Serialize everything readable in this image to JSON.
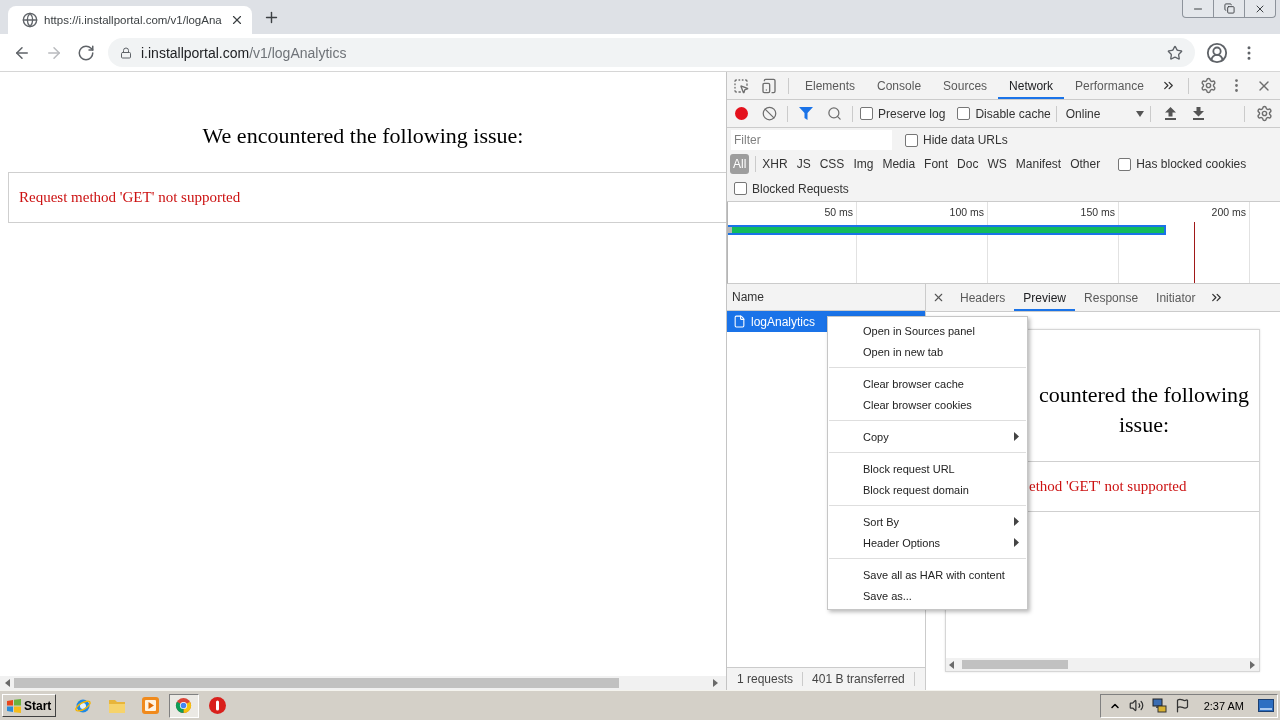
{
  "browser_tabs": [
    {
      "title": "https://i.installportal.com/v1/logAna",
      "selected": true
    }
  ],
  "address_bar": {
    "nav_buttons": [
      {
        "kind": "back",
        "disabled": false
      },
      {
        "kind": "forward",
        "disabled": true
      },
      {
        "kind": "reload",
        "disabled": false
      }
    ],
    "url_host": "i.installportal.com",
    "url_path": "/v1/logAnalytics"
  },
  "page": {
    "heading": "We encountered the following issue:",
    "error": "Request method 'GET' not supported"
  },
  "devtools": {
    "tabs": [
      {
        "label": "Elements",
        "selected": false
      },
      {
        "label": "Console",
        "selected": false
      },
      {
        "label": "Sources",
        "selected": false
      },
      {
        "label": "Network",
        "selected": true
      },
      {
        "label": "Performance",
        "selected": false
      }
    ],
    "toolbar": {
      "recording": true,
      "filter_active": true,
      "preserve_log": {
        "label": "Preserve log",
        "checked": false
      },
      "disable_cache": {
        "label": "Disable cache",
        "checked": false
      },
      "throttling": "Online"
    },
    "filter": {
      "placeholder": "Filter",
      "hide_data_urls": {
        "label": "Hide data URLs",
        "checked": false
      }
    },
    "type_filters": [
      {
        "label": "All",
        "selected": true
      },
      {
        "label": "XHR",
        "selected": false
      },
      {
        "label": "JS",
        "selected": false
      },
      {
        "label": "CSS",
        "selected": false
      },
      {
        "label": "Img",
        "selected": false
      },
      {
        "label": "Media",
        "selected": false
      },
      {
        "label": "Font",
        "selected": false
      },
      {
        "label": "Doc",
        "selected": false
      },
      {
        "label": "WS",
        "selected": false
      },
      {
        "label": "Manifest",
        "selected": false
      },
      {
        "label": "Other",
        "selected": false
      }
    ],
    "has_blocked_cookies": {
      "label": "Has blocked cookies",
      "checked": false
    },
    "blocked_requests": {
      "label": "Blocked Requests",
      "checked": false
    },
    "timeline": {
      "tick_labels": [
        "50 ms",
        "100 ms",
        "150 ms",
        "200 ms"
      ]
    },
    "requests": {
      "column": "Name",
      "rows": [
        {
          "name": "logAnalytics",
          "selected": true
        }
      ]
    },
    "detail_tabs": [
      {
        "label": "Headers",
        "selected": false
      },
      {
        "label": "Preview",
        "selected": true
      },
      {
        "label": "Response",
        "selected": false
      },
      {
        "label": "Initiator",
        "selected": false
      }
    ],
    "preview": {
      "heading": "countered the following issue:",
      "error": "ethod 'GET' not supported"
    },
    "status_bar": [
      "1 requests",
      "401 B transferred"
    ],
    "context_menu": {
      "groups": [
        {
          "items": [
            {
              "label": "Open in Sources panel",
              "submenu": false
            },
            {
              "label": "Open in new tab",
              "submenu": false
            }
          ]
        },
        {
          "items": [
            {
              "label": "Clear browser cache",
              "submenu": false
            },
            {
              "label": "Clear browser cookies",
              "submenu": false
            }
          ]
        },
        {
          "items": [
            {
              "label": "Copy",
              "submenu": true
            }
          ]
        },
        {
          "items": [
            {
              "label": "Block request URL",
              "submenu": false
            },
            {
              "label": "Block request domain",
              "submenu": false
            }
          ]
        },
        {
          "items": [
            {
              "label": "Sort By",
              "submenu": true
            },
            {
              "label": "Header Options",
              "submenu": true
            }
          ]
        },
        {
          "items": [
            {
              "label": "Save all as HAR with content",
              "submenu": false
            },
            {
              "label": "Save as...",
              "submenu": false
            }
          ]
        }
      ]
    }
  },
  "taskbar": {
    "start": "Start",
    "apps": [
      {
        "kind": "ie",
        "active": false
      },
      {
        "kind": "folder",
        "active": false
      },
      {
        "kind": "media",
        "active": false
      },
      {
        "kind": "chrome",
        "active": true
      },
      {
        "kind": "stop",
        "active": false
      }
    ],
    "clock": "2:37 AM"
  }
}
